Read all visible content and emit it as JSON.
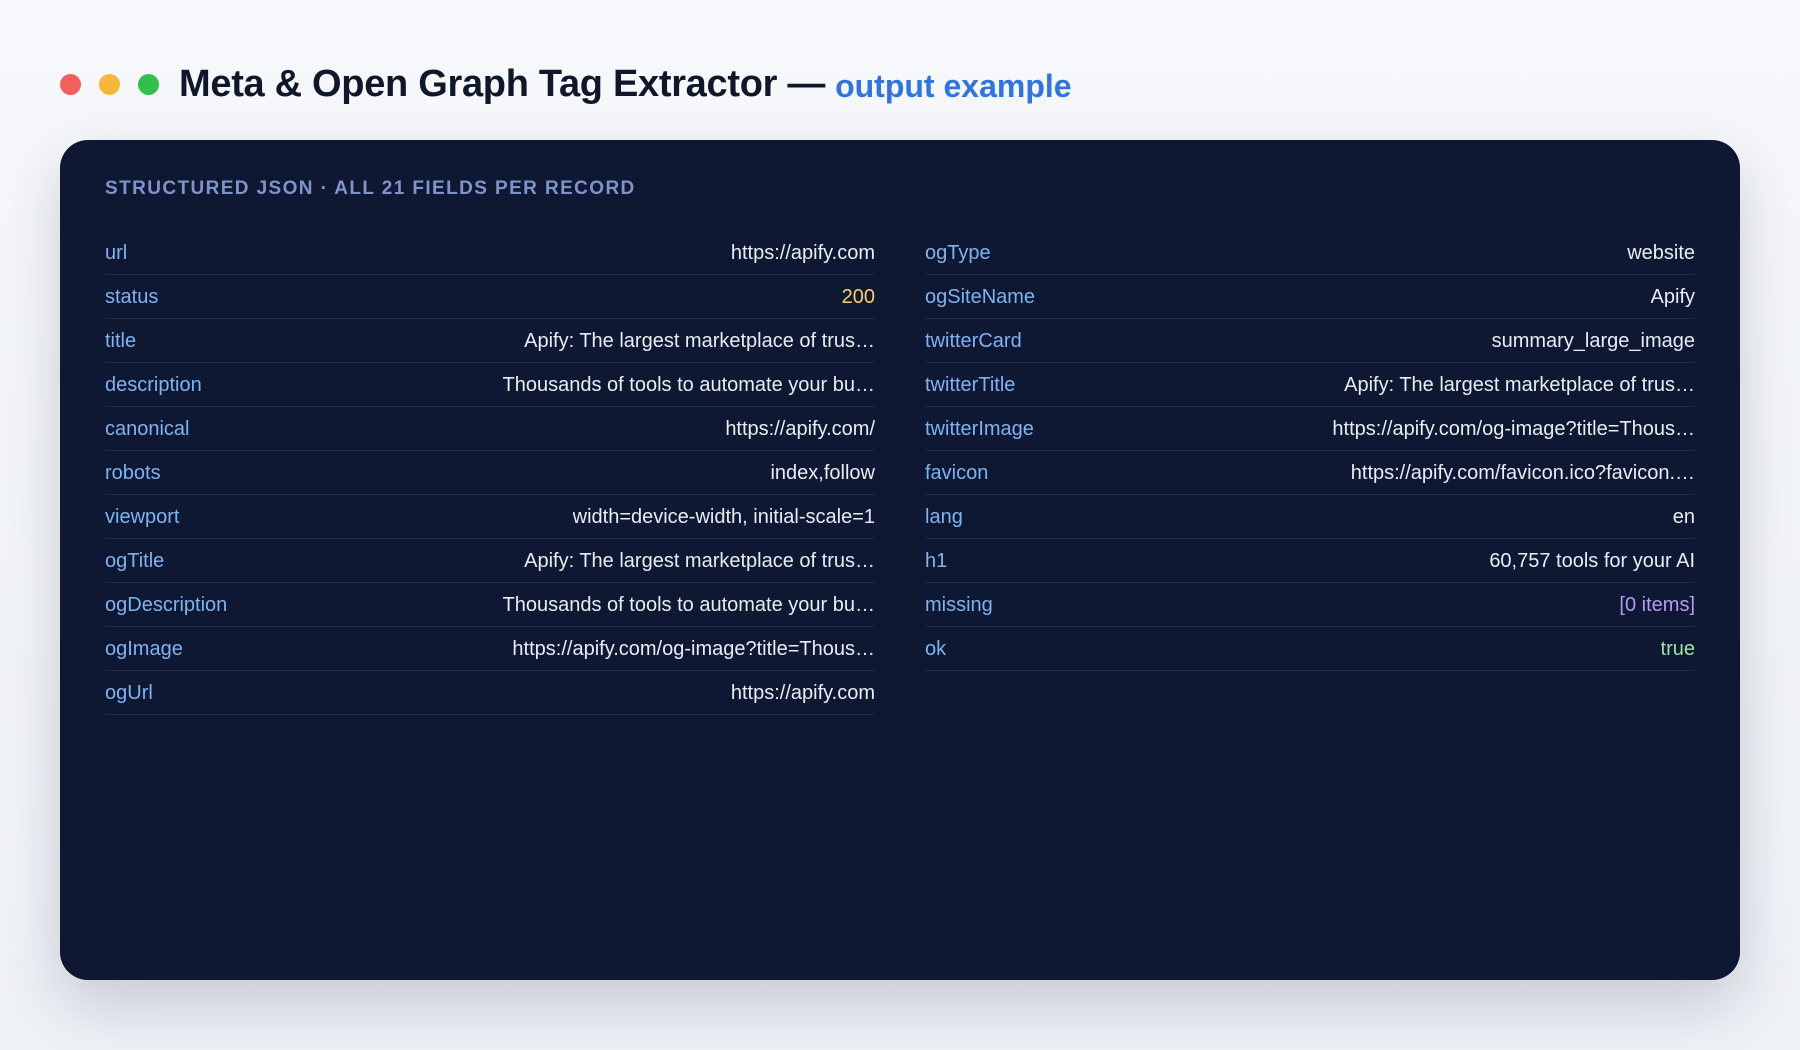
{
  "header": {
    "title": "Meta & Open Graph Tag Extractor —",
    "subtitle": "output example"
  },
  "card": {
    "label": "STRUCTURED JSON · ALL 21 FIELDS PER RECORD",
    "left_fields": [
      {
        "key": "url",
        "value": "https://apify.com",
        "kind": "string"
      },
      {
        "key": "status",
        "value": "200",
        "kind": "number"
      },
      {
        "key": "title",
        "value": "Apify: The largest marketplace of trus…",
        "kind": "string"
      },
      {
        "key": "description",
        "value": "Thousands of tools to automate your bu…",
        "kind": "string"
      },
      {
        "key": "canonical",
        "value": "https://apify.com/",
        "kind": "string"
      },
      {
        "key": "robots",
        "value": "index,follow",
        "kind": "string"
      },
      {
        "key": "viewport",
        "value": "width=device-width, initial-scale=1",
        "kind": "string"
      },
      {
        "key": "ogTitle",
        "value": "Apify: The largest marketplace of trus…",
        "kind": "string"
      },
      {
        "key": "ogDescription",
        "value": "Thousands of tools to automate your bu…",
        "kind": "string"
      },
      {
        "key": "ogImage",
        "value": "https://apify.com/og-image?title=Thous…",
        "kind": "string"
      },
      {
        "key": "ogUrl",
        "value": "https://apify.com",
        "kind": "string"
      }
    ],
    "right_fields": [
      {
        "key": "ogType",
        "value": "website",
        "kind": "string"
      },
      {
        "key": "ogSiteName",
        "value": "Apify",
        "kind": "string"
      },
      {
        "key": "twitterCard",
        "value": "summary_large_image",
        "kind": "string"
      },
      {
        "key": "twitterTitle",
        "value": "Apify: The largest marketplace of trus…",
        "kind": "string"
      },
      {
        "key": "twitterImage",
        "value": "https://apify.com/og-image?title=Thous…",
        "kind": "string"
      },
      {
        "key": "favicon",
        "value": "https://apify.com/favicon.ico?favicon.…",
        "kind": "string"
      },
      {
        "key": "lang",
        "value": "en",
        "kind": "string"
      },
      {
        "key": "h1",
        "value": "60,757 tools for your AI",
        "kind": "string"
      },
      {
        "key": "missing",
        "value": "[0 items]",
        "kind": "array"
      },
      {
        "key": "ok",
        "value": "true",
        "kind": "boolean"
      }
    ]
  },
  "colors": {
    "key": "#7fb3f0",
    "string_value": "#e8ecf4",
    "number_value": "#f4cf6e",
    "array_value": "#b39bf0",
    "boolean_value": "#9fe0a6",
    "accent": "#2f74e0"
  }
}
